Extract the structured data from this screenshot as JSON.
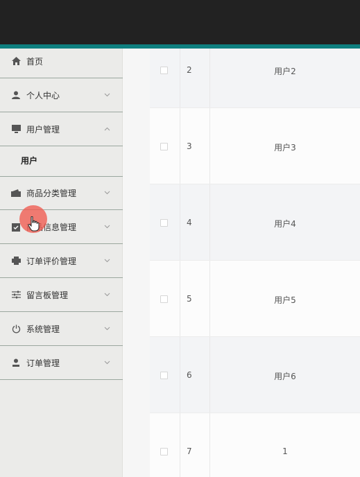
{
  "sidebar": {
    "items": [
      {
        "label": "首页",
        "icon": "home-icon",
        "chevron": ""
      },
      {
        "label": "个人中心",
        "icon": "person-icon",
        "chevron": "chevron-down-icon"
      },
      {
        "label": "用户管理",
        "icon": "monitor-icon",
        "chevron": "chevron-up-icon"
      },
      {
        "label": "商品分类管理",
        "icon": "wallet-icon",
        "chevron": "chevron-down-icon"
      },
      {
        "label": "商品信息管理",
        "icon": "clipboard-icon",
        "chevron": "chevron-down-icon"
      },
      {
        "label": "订单评价管理",
        "icon": "printer-icon",
        "chevron": "chevron-down-icon"
      },
      {
        "label": "留言板管理",
        "icon": "sliders-icon",
        "chevron": "chevron-down-icon"
      },
      {
        "label": "系统管理",
        "icon": "power-icon",
        "chevron": "chevron-down-icon"
      },
      {
        "label": "订单管理",
        "icon": "user-icon",
        "chevron": "chevron-down-icon"
      }
    ],
    "submenu": {
      "label": "用户"
    }
  },
  "table": {
    "rows": [
      {
        "index": "2",
        "name": "用户2"
      },
      {
        "index": "3",
        "name": "用户3"
      },
      {
        "index": "4",
        "name": "用户4"
      },
      {
        "index": "5",
        "name": "用户5"
      },
      {
        "index": "6",
        "name": "用户6"
      },
      {
        "index": "7",
        "name": "1"
      }
    ]
  },
  "colors": {
    "topbar": "#222222",
    "accent": "#0f7f7f",
    "sidebar": "#ebebe9",
    "cursor": "#f05a50"
  }
}
